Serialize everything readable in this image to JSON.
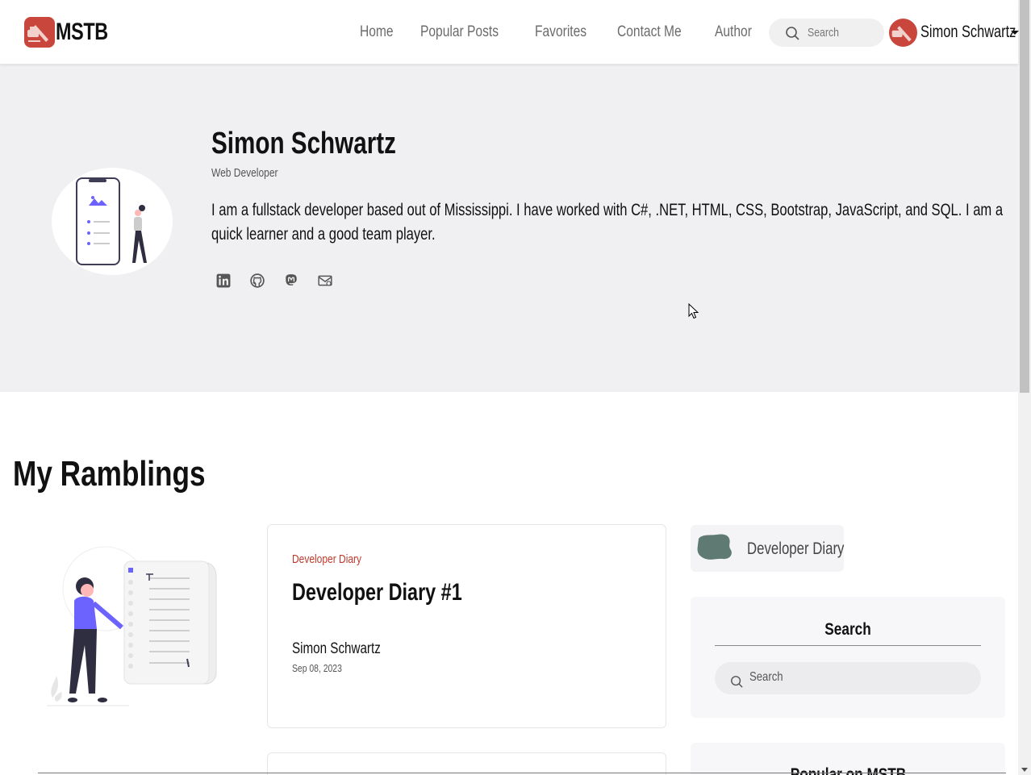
{
  "brand": {
    "name": "MSTB",
    "logo": "mstb-logo"
  },
  "nav": {
    "links": [
      "Home",
      "Popular Posts",
      "Favorites",
      "Contact Me",
      "Author"
    ],
    "search_placeholder": "Search",
    "user_name": "Simon Schwartz"
  },
  "hero": {
    "name": "Simon Schwartz",
    "title": "Web Developer",
    "bio": "I am a fullstack developer based out of Mississippi. I have worked with C#, .NET, HTML, CSS, Bootstrap, JavaScript, and SQL. I am a quick learner and a good team player.",
    "socials": [
      "linkedin-icon",
      "github-icon",
      "mastodon-icon",
      "mail-icon"
    ]
  },
  "main": {
    "section_title": "My Ramblings",
    "posts": [
      {
        "category": "Developer Diary",
        "title": "Developer Diary #1",
        "author": "Simon Schwartz",
        "date": "Sep 08, 2023"
      }
    ]
  },
  "sidebar": {
    "category_chip": "Developer Diary",
    "search_widget": {
      "title": "Search",
      "placeholder": "Search"
    },
    "popular_widget": {
      "title": "Popular on MSTB"
    }
  },
  "colors": {
    "brand_red": "#c9463d",
    "category_red": "#c0392b",
    "hero_bg": "#f0f0f2",
    "accent_purple": "#6c63ff"
  }
}
